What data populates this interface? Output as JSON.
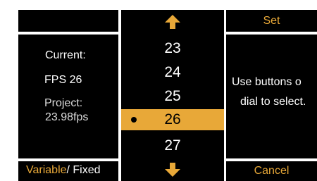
{
  "left": {
    "current_label": "Current:",
    "current_value": "FPS 26",
    "project_label": "Project:",
    "project_value": "23.98fps",
    "mode_variable": "Variable",
    "mode_fixed": "/ Fixed"
  },
  "picker": {
    "values": [
      "23",
      "24",
      "25",
      "26",
      "27"
    ],
    "selected": "26",
    "up_icon": "arrow-up-icon",
    "down_icon": "arrow-down-icon"
  },
  "right": {
    "set_label": "Set",
    "help_line1": "Use buttons o",
    "help_line2": "dial to select.",
    "cancel_label": "Cancel"
  },
  "colors": {
    "accent": "#e8a838",
    "panel": "#000000",
    "text": "#ffffff"
  }
}
